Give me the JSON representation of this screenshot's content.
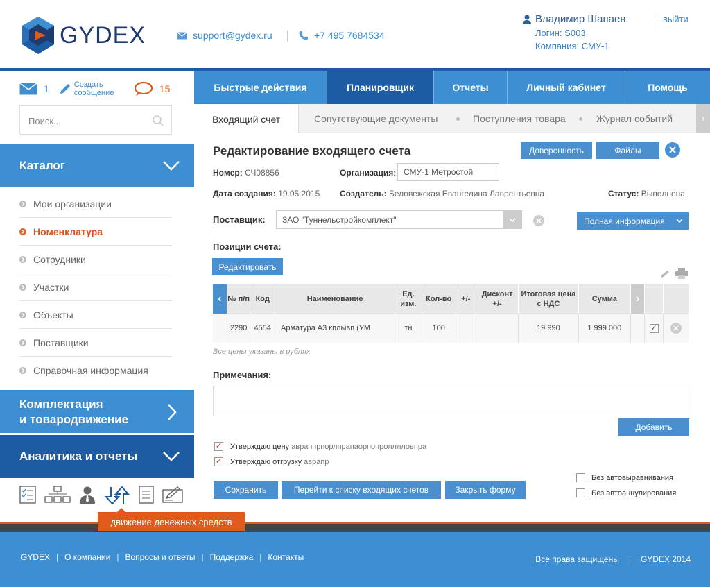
{
  "header": {
    "logo_text": "GYDEX",
    "email": "support@gydex.ru",
    "phone": "+7 495 7684534",
    "user_name": "Владимир Шапаев",
    "logout": "выйти",
    "login": "Логин: S003",
    "company": "Компания: СМУ-1"
  },
  "sidebar": {
    "mail_count": "1",
    "create_msg": "Создать сообщение",
    "chat_count": "15",
    "search_placeholder": "Поиск...",
    "catalog": "Каталог",
    "items": [
      {
        "label": "Мои организации",
        "active": false
      },
      {
        "label": "Номенклатура",
        "active": true
      },
      {
        "label": "Сотрудники",
        "active": false
      },
      {
        "label": "Участки",
        "active": false
      },
      {
        "label": "Объекты",
        "active": false
      },
      {
        "label": "Поставщики",
        "active": false
      },
      {
        "label": "Справочная информация",
        "active": false
      }
    ],
    "section2_line1": "Комплектация",
    "section2_line2": "и товародвижение",
    "section3": "Аналитика и отчеты",
    "tooltip": "движение денежных средств"
  },
  "nav": [
    "Быстрые действия",
    "Планировщик",
    "Отчеты",
    "Личный кабинет",
    "Помощь"
  ],
  "tabs": [
    "Входящий счет",
    "Сопутствующие документы",
    "Поступления товара",
    "Журнал событий"
  ],
  "form": {
    "title": "Редактирование входящего счета",
    "btn_trust": "Доверенность",
    "btn_files": "Файлы",
    "number_label": "Номер:",
    "number": "СЧ08856",
    "org_label": "Организация:",
    "org": "СМУ-1 Метростой",
    "created_label": "Дата создания:",
    "created": "19.05.2015",
    "creator_label": "Создатель:",
    "creator": "Беловежская Евангелина Лаврентьевна",
    "status_label": "Статус:",
    "status": "Выполнена",
    "supplier_label": "Поставщик:",
    "supplier": "ЗАО \"Туннельстройкомплект\"",
    "full_info": "Полная информация",
    "positions_label": "Позиции счета:",
    "edit_btn": "Редактировать",
    "table_headers": [
      "№ п/п",
      "Код",
      "Наименование",
      "Ед. изм.",
      "Кол-во",
      "+/-",
      "Дисконт +/-",
      "Итоговая цена с НДС",
      "Сумма"
    ],
    "row": {
      "n": "2290",
      "code": "4554",
      "name": "Арматура А3 кплывп (УМ",
      "unit": "тн",
      "qty": "100",
      "pm": "",
      "disc": "",
      "price": "19 990",
      "sum": "1 999 000"
    },
    "prices_note": "Все цены указаны в рублях",
    "notes_label": "Примечания:",
    "add_btn": "Добавить",
    "approve_price": "Утверждаю цену",
    "approve_price_note": "авраппрпорлпрапаорпопролллловпра",
    "approve_ship": "Утверждаю отгрузку",
    "approve_ship_note": "аврапр",
    "save": "Сохранить",
    "goto_list": "Перейти к списку входящих счетов",
    "close_form": "Закрыть форму",
    "no_autoalign": "Без автовыравнивания",
    "no_autocancel": "Без автоаннулирования"
  },
  "footer": {
    "links": [
      "GYDEX",
      "О компании",
      "Вопросы и ответы",
      "Поддержка",
      "Контакты"
    ],
    "rights": "Все права защищены",
    "copy": "GYDEX 2014"
  }
}
